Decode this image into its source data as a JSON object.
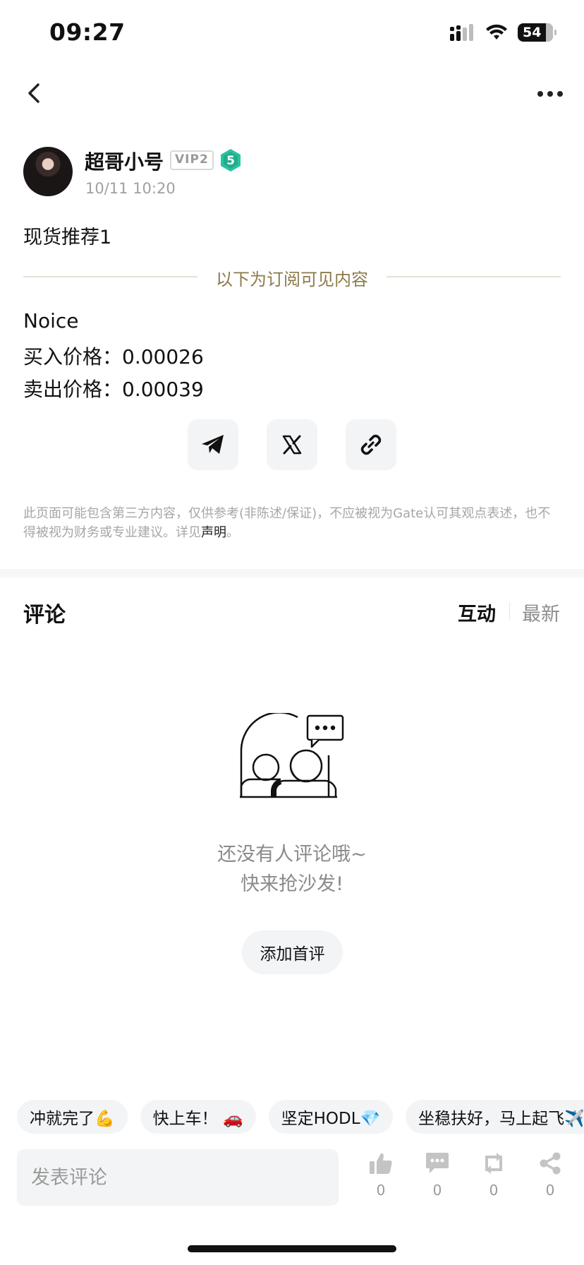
{
  "status_bar": {
    "time": "09:27",
    "battery": "54"
  },
  "author": {
    "name": "超哥小号",
    "vip": "VIP2",
    "level": "5",
    "time": "10/11 10:20"
  },
  "post": {
    "title": "现货推荐1",
    "subscription_divider": "以下为订阅可见内容",
    "lines": [
      "Noice",
      "买入价格：0.00026",
      "卖出价格：0.00039"
    ]
  },
  "share": {
    "telegram": "telegram-icon",
    "x": "x-icon",
    "link": "link-icon"
  },
  "disclaimer": {
    "text": "此页面可能包含第三方内容，仅供参考(非陈述/保证)，不应被视为Gate认可其观点表述，也不得被视为财务或专业建议。详见",
    "link": "声明",
    "end": "。"
  },
  "comments": {
    "title": "评论",
    "tabs": [
      {
        "label": "互动",
        "active": true
      },
      {
        "label": "最新",
        "active": false
      }
    ],
    "empty_line1": "还没有人评论哦~",
    "empty_line2": "快来抢沙发!",
    "first_comment_button": "添加首评"
  },
  "quick_replies": [
    "冲就完了💪",
    "快上车！ 🚗",
    "坚定HODL💎",
    "坐稳扶好，马上起飞✈️"
  ],
  "bottom_bar": {
    "input_placeholder": "发表评论",
    "actions": [
      {
        "name": "like",
        "icon": "thumbs-up-icon",
        "count": "0"
      },
      {
        "name": "comment",
        "icon": "comment-icon",
        "count": "0"
      },
      {
        "name": "repost",
        "icon": "repost-icon",
        "count": "0"
      },
      {
        "name": "share",
        "icon": "share-icon",
        "count": "0"
      }
    ]
  },
  "colors": {
    "accent_gold": "#8c7a4a",
    "level_badge": "#29c3a0",
    "chip_bg": "#f3f4f6"
  }
}
